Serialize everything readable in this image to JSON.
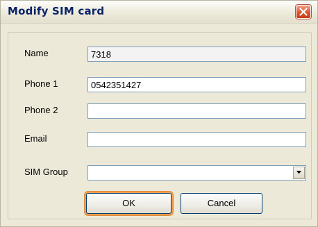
{
  "window": {
    "title": "Modify SIM card"
  },
  "form": {
    "name_label": "Name",
    "name_value": "7318",
    "phone1_label": "Phone 1",
    "phone1_value": "0542351427",
    "phone2_label": "Phone 2",
    "phone2_value": "",
    "email_label": "Email",
    "email_value": "",
    "sim_group_label": "SIM Group",
    "sim_group_value": ""
  },
  "buttons": {
    "ok_label": "OK",
    "cancel_label": "Cancel"
  },
  "icons": {
    "close": "close-icon",
    "dropdown": "chevron-down-icon"
  },
  "colors": {
    "title_text": "#0a246a",
    "close_button": "#e0522e",
    "focus_ring": "#f0a050",
    "field_border": "#7f9db9"
  }
}
